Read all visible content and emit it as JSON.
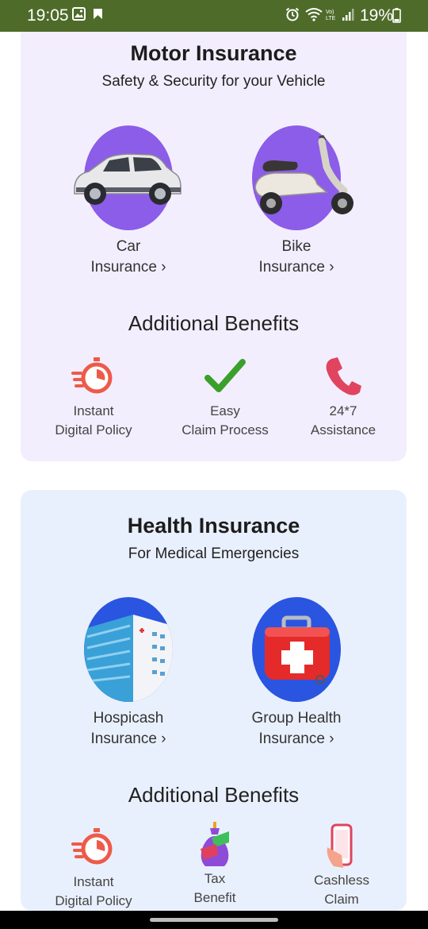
{
  "status_bar": {
    "time": "19:05",
    "battery": "19%",
    "left_icons": [
      "gallery-icon",
      "notification-icon"
    ],
    "right_icons": [
      "alarm-icon",
      "wifi-calling-icon",
      "volte-icon",
      "signal-icon",
      "battery-icon"
    ],
    "background": "#4e6b2a"
  },
  "motor": {
    "title": "Motor Insurance",
    "subtitle": "Safety & Security for your Vehicle",
    "background": "#f3eefd",
    "accent": "#8b5de8",
    "products": [
      {
        "line1": "Car",
        "line2": "Insurance ›",
        "icon": "car-icon"
      },
      {
        "line1": "Bike",
        "line2": "Insurance ›",
        "icon": "scooter-icon"
      }
    ],
    "benefits_title": "Additional Benefits",
    "benefits": [
      {
        "line1": "Instant",
        "line2": "Digital Policy",
        "icon": "fast-timer-icon"
      },
      {
        "line1": "Easy",
        "line2": "Claim Process",
        "icon": "checkmark-icon"
      },
      {
        "line1": "24*7",
        "line2": "Assistance",
        "icon": "phone-icon"
      }
    ]
  },
  "health": {
    "title": "Health Insurance",
    "subtitle": "For Medical Emergencies",
    "background": "#e9f0fd",
    "accent": "#2a55e0",
    "products": [
      {
        "line1": "Hospicash",
        "line2": "Insurance ›",
        "icon": "hospital-icon"
      },
      {
        "line1": "Group Health",
        "line2": "Insurance ›",
        "icon": "first-aid-kit-icon"
      }
    ],
    "benefits_title": "Additional Benefits",
    "benefits": [
      {
        "line1": "Instant",
        "line2": "Digital Policy",
        "icon": "fast-timer-icon"
      },
      {
        "line1": "Tax",
        "line2": "Benefit",
        "icon": "money-bag-icon"
      },
      {
        "line1": "Cashless",
        "line2": "Claim",
        "icon": "mobile-phone-icon"
      }
    ]
  }
}
